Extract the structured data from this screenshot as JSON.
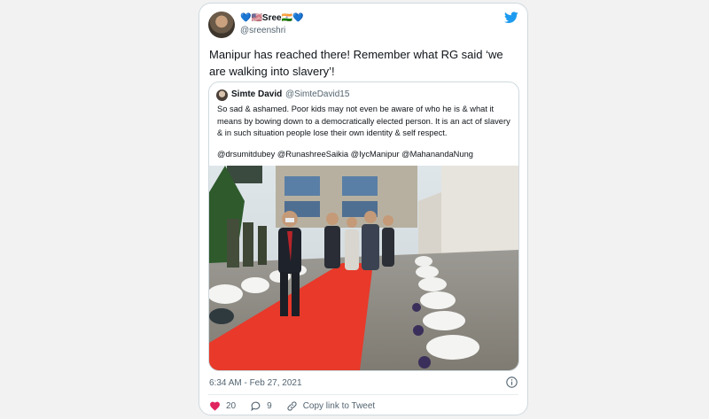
{
  "author": {
    "display_name": "💙🇺🇸Sree🇮🇳💙",
    "handle": "@sreenshri"
  },
  "tweet": {
    "text": "Manipur has reached there! Remember what RG said ‘we are walking into slavery’!",
    "timestamp": "6:34 AM - Feb 27, 2021",
    "likes": "20",
    "replies": "9",
    "copy_link_label": "Copy link to Tweet"
  },
  "quoted": {
    "display_name": "Simte David",
    "handle": "@SimteDavid15",
    "body": "So sad & ashamed. Poor kids may not even be aware of who he is & what it means by bowing down to a democratically elected person. It is an act of slavery & in such situation people lose their own identity & self respect.",
    "mentions": "@drsumitdubey @RunashreeSaikia @IycManipur @MahanandaNung"
  },
  "icons": {
    "brand": "twitter-bird-icon",
    "info": "info-icon",
    "like": "heart-icon",
    "reply": "reply-icon",
    "copy": "link-icon"
  },
  "colors": {
    "twitter_blue": "#1d9bf0",
    "like_red": "#e0245e",
    "text_secondary": "#536471",
    "border": "#cfd9de",
    "red_carpet": "#e8392a"
  }
}
